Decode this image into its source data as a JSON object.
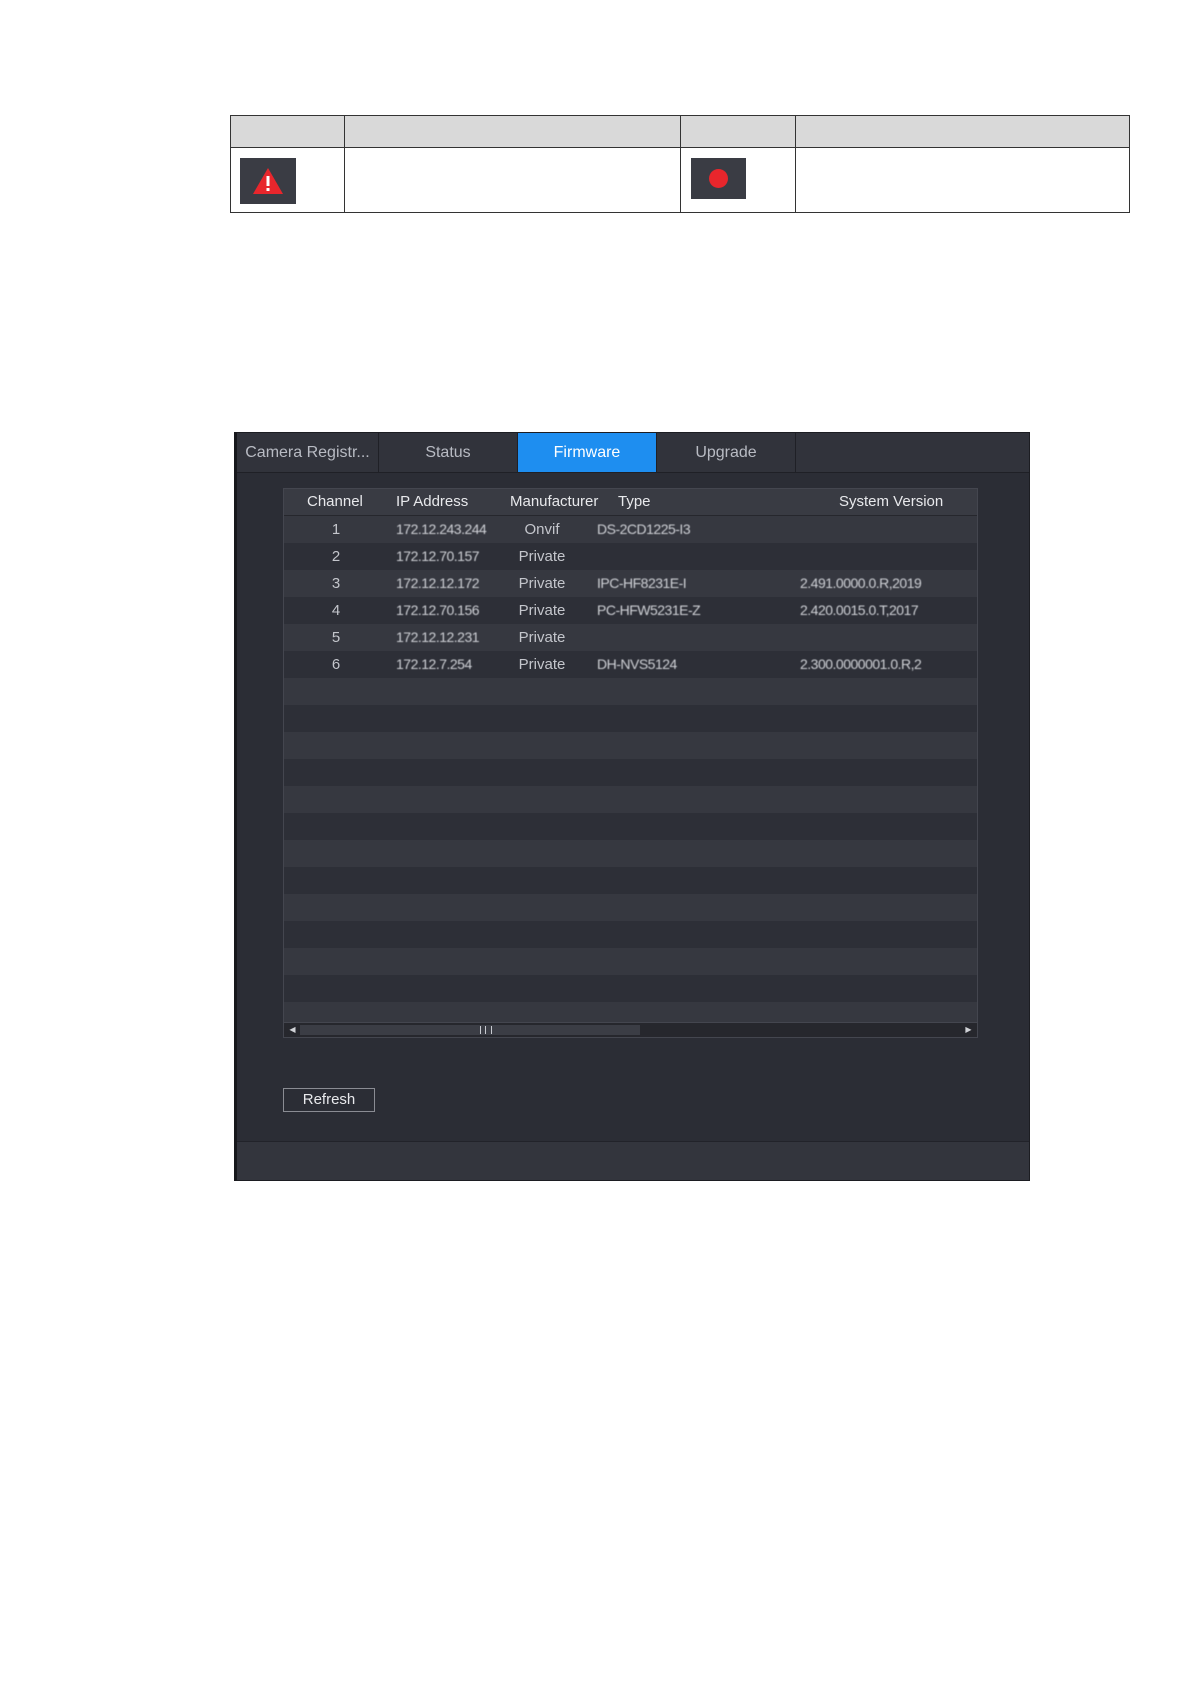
{
  "legend": {
    "icons": [
      "warning-triangle-icon",
      "record-dot-icon"
    ],
    "colors": {
      "warning": "#e8262c",
      "record": "#e8262c",
      "icon_bg": "#3a3c44",
      "header_bg": "#d9d9d9"
    }
  },
  "tabs": [
    {
      "label": "Camera Registr...",
      "active": false
    },
    {
      "label": "Status",
      "active": false
    },
    {
      "label": "Firmware",
      "active": true
    },
    {
      "label": "Upgrade",
      "active": false
    }
  ],
  "accent_color": "#1e8ef0",
  "table": {
    "columns": [
      "Channel",
      "IP Address",
      "Manufacturer",
      "Type",
      "System Version"
    ],
    "rows": [
      {
        "channel": "1",
        "ip": "172.12.243.244",
        "manufacturer": "Onvif",
        "type": "DS-2CD1225-I3",
        "version": ""
      },
      {
        "channel": "2",
        "ip": "172.12.70.157",
        "manufacturer": "Private",
        "type": "",
        "version": ""
      },
      {
        "channel": "3",
        "ip": "172.12.12.172",
        "manufacturer": "Private",
        "type": "IPC-HF8231E-I",
        "version": "2.491.0000.0.R,2019"
      },
      {
        "channel": "4",
        "ip": "172.12.70.156",
        "manufacturer": "Private",
        "type": "PC-HFW5231E-Z",
        "version": "2.420.0015.0.T,2017"
      },
      {
        "channel": "5",
        "ip": "172.12.12.231",
        "manufacturer": "Private",
        "type": "",
        "version": ""
      },
      {
        "channel": "6",
        "ip": "172.12.7.254",
        "manufacturer": "Private",
        "type": "DH-NVS5124",
        "version": "2.300.0000001.0.R,2"
      }
    ],
    "empty_rows": 13
  },
  "buttons": {
    "refresh": "Refresh"
  }
}
